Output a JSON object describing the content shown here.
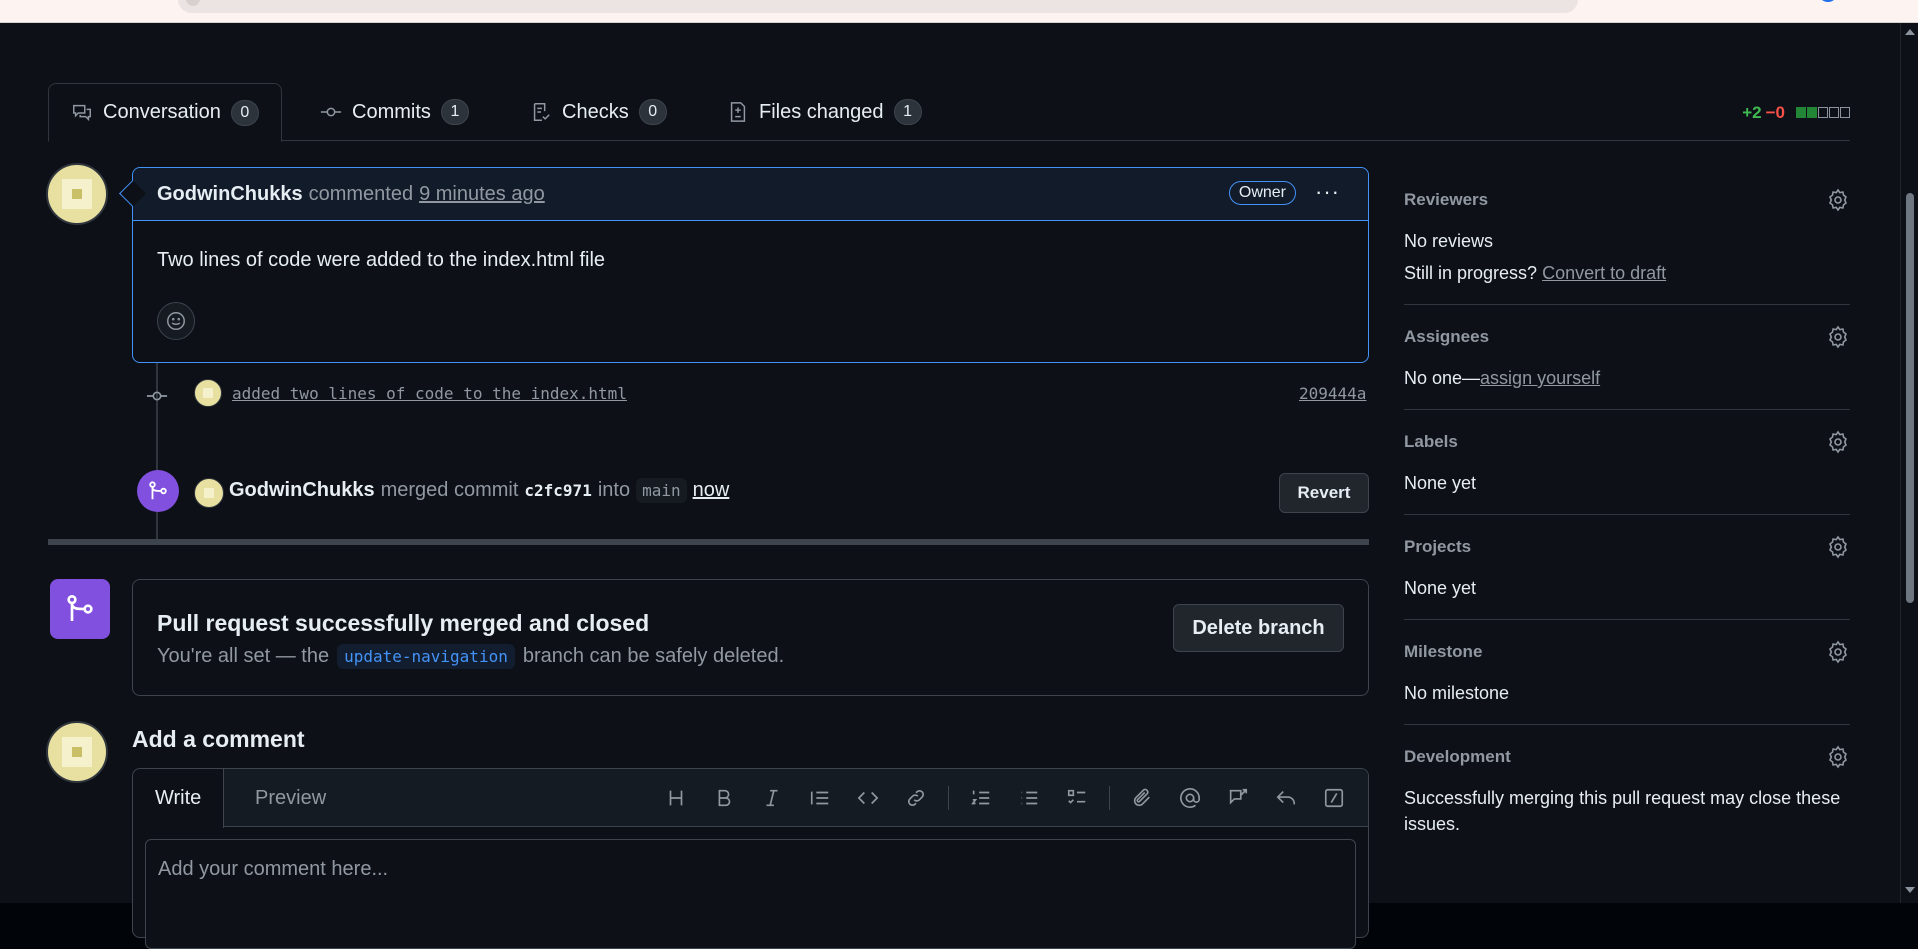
{
  "tabs": [
    {
      "label": "Conversation",
      "count": "0",
      "icon": "comment-discussion-icon"
    },
    {
      "label": "Commits",
      "count": "1",
      "icon": "git-commit-icon"
    },
    {
      "label": "Checks",
      "count": "0",
      "icon": "checklist-icon"
    },
    {
      "label": "Files changed",
      "count": "1",
      "icon": "file-diff-icon"
    }
  ],
  "diffstat": {
    "additions": "+2",
    "deletions": "−0"
  },
  "comment": {
    "author": "GodwinChukks",
    "action": "commented",
    "time": "9 minutes ago",
    "badge": "Owner",
    "body": "Two lines of code were added to the index.html file"
  },
  "commit": {
    "message": "added two lines of code to the index.html",
    "sha": "209444a"
  },
  "merge": {
    "author": "GodwinChukks",
    "action": "merged commit",
    "commit": "c2fc971",
    "into": "into",
    "branch": "main",
    "time": "now",
    "revert_label": "Revert"
  },
  "merged_box": {
    "title": "Pull request successfully merged and closed",
    "sub_prefix": "You're all set — the",
    "branch": "update-navigation",
    "sub_suffix": "branch can be safely deleted.",
    "delete_label": "Delete branch"
  },
  "add_comment": {
    "title": "Add a comment",
    "write_tab": "Write",
    "preview_tab": "Preview",
    "placeholder": "Add your comment here..."
  },
  "sidebar": {
    "reviewers": {
      "title": "Reviewers",
      "value": "No reviews",
      "draft_prefix": "Still in progress?",
      "draft_link": "Convert to draft"
    },
    "assignees": {
      "title": "Assignees",
      "value": "No one—",
      "link": "assign yourself"
    },
    "labels": {
      "title": "Labels",
      "value": "None yet"
    },
    "projects": {
      "title": "Projects",
      "value": "None yet"
    },
    "milestone": {
      "title": "Milestone",
      "value": "No milestone"
    },
    "development": {
      "title": "Development",
      "value": "Successfully merging this pull request may close these issues."
    }
  },
  "colors": {
    "accent": "#4493f8",
    "merged": "#8250df",
    "added": "#3fb950",
    "deleted": "#f85149"
  }
}
